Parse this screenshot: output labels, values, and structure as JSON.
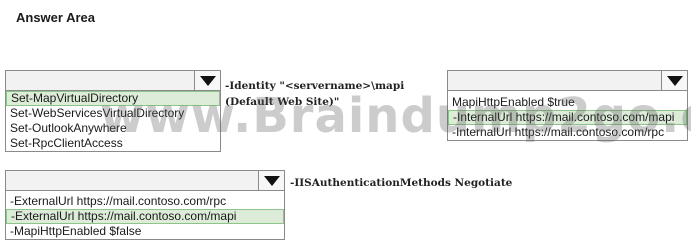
{
  "answer_area": {
    "title": "Answer Area"
  },
  "dropdown1": {
    "options": [
      "Set-MapVirtualDirectory",
      "Set-WebServicesVirtualDirectory",
      "Set-OutlookAnywhere",
      "Set-RpcClientAccess"
    ],
    "selected_index": 0
  },
  "dropdown2": {
    "options": [
      "MapiHttpEnabled $true",
      "-InternalUrl https://mail.contoso.com/mapi",
      "-InternalUrl https://mail.contoso.com/rpc"
    ],
    "selected_index": 1
  },
  "dropdown3": {
    "options": [
      "-ExternalUrl https://mail.contoso.com/rpc",
      "-ExternalUrl https://mail.contoso.com/mapi",
      "-MapiHttpEnabled $false"
    ],
    "selected_index": 1
  },
  "code": {
    "identity_line1": "-Identity \"<servername>\\mapi",
    "identity_line2": "(Default Web Site)\"",
    "iis_auth": "-IISAuthenticationMethods Negotiate"
  },
  "watermark": "www.Braindump2go.com",
  "colors": {
    "selected_bg": "#dcecd9",
    "selected_border": "#8cc48a",
    "arrow": "#111111"
  }
}
